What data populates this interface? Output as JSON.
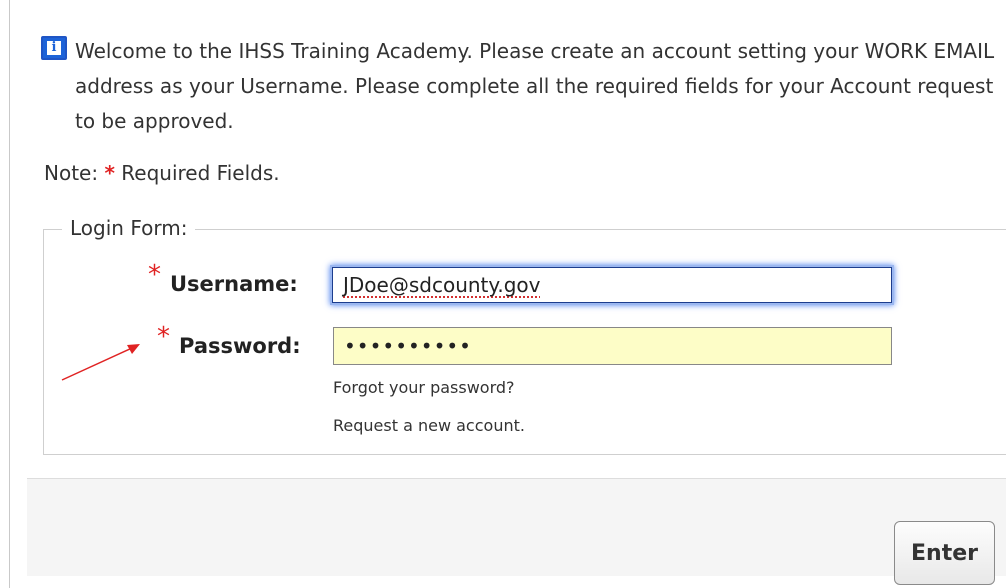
{
  "info": {
    "icon": "info-icon",
    "icon_glyph": "i",
    "text": "Welcome to the IHSS Training Academy. Please create an account setting your WORK EMAIL address as your Username. Please complete all the required fields for your Account request to be approved."
  },
  "note": {
    "prefix": "Note:",
    "star": "*",
    "text": "Required Fields."
  },
  "login_form": {
    "legend": "Login Form:",
    "username_label": "Username:",
    "username_value": "JDoe@sdcounty.gov",
    "password_label": "Password:",
    "password_value": "••••••••••",
    "required_star": "*",
    "forgot_link": "Forgot your password?",
    "request_link": "Request a new account."
  },
  "footer": {
    "enter_label": "Enter"
  },
  "colors": {
    "required": "#e02323",
    "info_blue": "#1d63d8",
    "password_bg": "#fdfdc7",
    "arrow": "#e02323"
  }
}
